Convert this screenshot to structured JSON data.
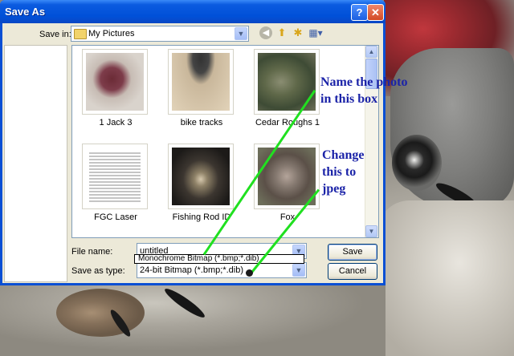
{
  "dialog": {
    "title": "Save As",
    "help_glyph": "?",
    "close_glyph": "✕"
  },
  "toolbar": {
    "save_in_label": "Save in:",
    "save_in_value": "My Pictures",
    "back_icon": "◀",
    "up_icon": "⬆",
    "new_folder_icon": "✱",
    "view_icon": "▦▾"
  },
  "files": [
    {
      "name": "1 Jack 3"
    },
    {
      "name": "bike tracks"
    },
    {
      "name": "Cedar Roughs 1"
    },
    {
      "name": "FGC Laser"
    },
    {
      "name": "Fishing Rod ID"
    },
    {
      "name": "Fox"
    }
  ],
  "form": {
    "file_name_label": "File name:",
    "file_name_value": "untitled",
    "save_as_type_label": "Save as type:",
    "save_as_type_value": "24-bit Bitmap (*.bmp;*.dib)",
    "dropdown_option": "Monochrome Bitmap (*.bmp;*.dib)",
    "save_button": "Save",
    "cancel_button": "Cancel"
  },
  "annotations": {
    "name_line1": "Name the photo",
    "name_line2": "in this box",
    "change_line1": "Change",
    "change_line2": "this to",
    "change_line3": "jpeg",
    "color": "#1b23a8",
    "line_color": "#20e020"
  }
}
